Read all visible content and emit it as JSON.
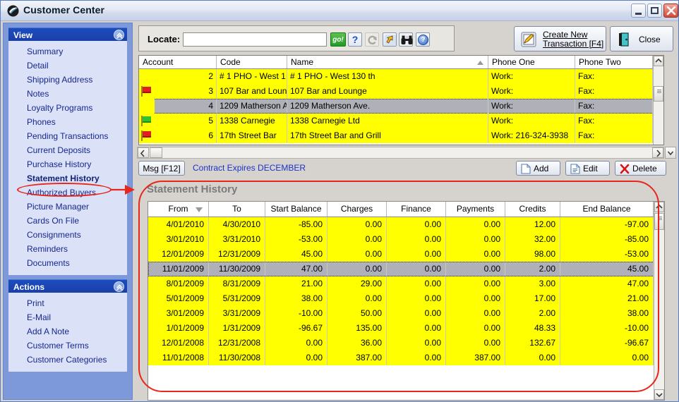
{
  "window": {
    "title": "Customer Center",
    "icon": "app-logo-icon",
    "minimize": "minimize-icon",
    "maximize": "maximize-icon",
    "close": "close-icon"
  },
  "sidebar": {
    "sections": [
      {
        "title": "View",
        "collapse_icon": "chevron-up-icon",
        "items": [
          {
            "label": "Summary",
            "active": false
          },
          {
            "label": "Detail",
            "active": false
          },
          {
            "label": "Shipping Address",
            "active": false
          },
          {
            "label": "Notes",
            "active": false
          },
          {
            "label": "Loyalty Programs",
            "active": false
          },
          {
            "label": "Phones",
            "active": false
          },
          {
            "label": "Pending Transactions",
            "active": false
          },
          {
            "label": "Current Deposits",
            "active": false
          },
          {
            "label": "Purchase History",
            "active": false
          },
          {
            "label": "Statement History",
            "active": true
          },
          {
            "label": "Authorized Buyers",
            "active": false
          },
          {
            "label": "Picture Manager",
            "active": false
          },
          {
            "label": "Cards On File",
            "active": false
          },
          {
            "label": "Consignments",
            "active": false
          },
          {
            "label": "Reminders",
            "active": false
          },
          {
            "label": "Documents",
            "active": false
          }
        ]
      },
      {
        "title": "Actions",
        "collapse_icon": "chevron-up-icon",
        "items": [
          {
            "label": "Print",
            "active": false
          },
          {
            "label": "E-Mail",
            "active": false
          },
          {
            "label": "Add A Note",
            "active": false
          },
          {
            "label": "Customer Terms",
            "active": false
          },
          {
            "label": "Customer Categories",
            "active": false
          }
        ]
      }
    ]
  },
  "toolbar": {
    "locate_label": "Locate:",
    "locate_value": "",
    "locate_placeholder": "",
    "go_label": "go!",
    "question_label": "?",
    "help_label": "?",
    "icons": {
      "refresh": "refresh-arrow-icon",
      "jump": "yellow-arrow-icon",
      "find": "binoculars-icon",
      "help": "help-circle-icon"
    },
    "create_new_transaction": {
      "line1": "Create New",
      "line2": "Transaction [F4]",
      "icon": "edit-document-icon"
    },
    "close_button": {
      "label": "Close",
      "icon": "exit-door-icon"
    }
  },
  "customer_grid": {
    "columns": [
      "Account",
      "Code",
      "Name",
      "Phone One",
      "Phone Two"
    ],
    "sorted_column": "Name",
    "sort_icon": "sort-ascending-icon",
    "rows": [
      {
        "flag": "none",
        "account": "2",
        "code": "# 1 PHO - West 1",
        "name": "# 1 PHO - West 130 th",
        "phone_one": "Work:",
        "phone_two": "Fax:",
        "selected": false
      },
      {
        "flag": "red",
        "account": "3",
        "code": "107 Bar and Loun",
        "name": "107 Bar and Lounge",
        "phone_one": "Work:",
        "phone_two": "Fax:",
        "selected": false
      },
      {
        "flag": "none",
        "account": "4",
        "code": "1209 Matherson A",
        "name": "1209 Matherson Ave.",
        "phone_one": "Work:",
        "phone_two": "Fax:",
        "selected": true
      },
      {
        "flag": "green",
        "account": "5",
        "code": "1338 Carnegie",
        "name": "1338 Carnegie Ltd",
        "phone_one": "Work:",
        "phone_two": "Fax:",
        "selected": false
      },
      {
        "flag": "red",
        "account": "6",
        "code": "17th Street Bar",
        "name": "17th Street Bar and Grill",
        "phone_one": "Work:  216-324-3938",
        "phone_two": "Fax:",
        "selected": false
      }
    ]
  },
  "action_row": {
    "msg_button": "Msg [F12]",
    "message_text": "Contract Expires DECEMBER",
    "add_button": "Add",
    "add_icon": "new-document-icon",
    "edit_button": "Edit",
    "edit_icon": "edit-document-icon",
    "delete_button": "Delete",
    "delete_icon": "red-x-icon"
  },
  "statement_history": {
    "title": "Statement History",
    "columns": [
      "From",
      "To",
      "Start Balance",
      "Charges",
      "Finance",
      "Payments",
      "Credits",
      "End Balance"
    ],
    "sorted_column": "From",
    "sort_icon": "sort-descending-icon",
    "rows": [
      {
        "from": "4/01/2010",
        "to": "4/30/2010",
        "start_balance": "-85.00",
        "charges": "0.00",
        "finance": "0.00",
        "payments": "0.00",
        "credits": "12.00",
        "end_balance": "-97.00",
        "selected": false
      },
      {
        "from": "3/01/2010",
        "to": "3/31/2010",
        "start_balance": "-53.00",
        "charges": "0.00",
        "finance": "0.00",
        "payments": "0.00",
        "credits": "32.00",
        "end_balance": "-85.00",
        "selected": false
      },
      {
        "from": "12/01/2009",
        "to": "12/31/2009",
        "start_balance": "45.00",
        "charges": "0.00",
        "finance": "0.00",
        "payments": "0.00",
        "credits": "98.00",
        "end_balance": "-53.00",
        "selected": false
      },
      {
        "from": "11/01/2009",
        "to": "11/30/2009",
        "start_balance": "47.00",
        "charges": "0.00",
        "finance": "0.00",
        "payments": "0.00",
        "credits": "2.00",
        "end_balance": "45.00",
        "selected": true
      },
      {
        "from": "8/01/2009",
        "to": "8/31/2009",
        "start_balance": "21.00",
        "charges": "29.00",
        "finance": "0.00",
        "payments": "0.00",
        "credits": "3.00",
        "end_balance": "47.00",
        "selected": false
      },
      {
        "from": "5/01/2009",
        "to": "5/31/2009",
        "start_balance": "38.00",
        "charges": "0.00",
        "finance": "0.00",
        "payments": "0.00",
        "credits": "17.00",
        "end_balance": "21.00",
        "selected": false
      },
      {
        "from": "3/01/2009",
        "to": "3/31/2009",
        "start_balance": "-10.00",
        "charges": "50.00",
        "finance": "0.00",
        "payments": "0.00",
        "credits": "2.00",
        "end_balance": "38.00",
        "selected": false
      },
      {
        "from": "1/01/2009",
        "to": "1/31/2009",
        "start_balance": "-96.67",
        "charges": "135.00",
        "finance": "0.00",
        "payments": "0.00",
        "credits": "48.33",
        "end_balance": "-10.00",
        "selected": false
      },
      {
        "from": "12/01/2008",
        "to": "12/31/2008",
        "start_balance": "0.00",
        "charges": "36.00",
        "finance": "0.00",
        "payments": "0.00",
        "credits": "132.67",
        "end_balance": "-96.67",
        "selected": false
      },
      {
        "from": "11/01/2008",
        "to": "11/30/2008",
        "start_balance": "0.00",
        "charges": "387.00",
        "finance": "0.00",
        "payments": "387.00",
        "credits": "0.00",
        "end_balance": "0.00",
        "selected": false
      }
    ]
  },
  "annotations": {
    "highlight_color": "#e8261c",
    "ellipse_target": "Statement History",
    "arrow_icon": "red-arrow-right-icon"
  },
  "colors": {
    "row_highlight": "#ffff00",
    "row_selected": "#b0b0b8",
    "sidebar_panel": "#7e99da",
    "sidebar_header": "#1b4dbe",
    "sidebar_body": "#dbe2f7",
    "link_text": "#16268f",
    "message_text": "#1a33c8"
  }
}
